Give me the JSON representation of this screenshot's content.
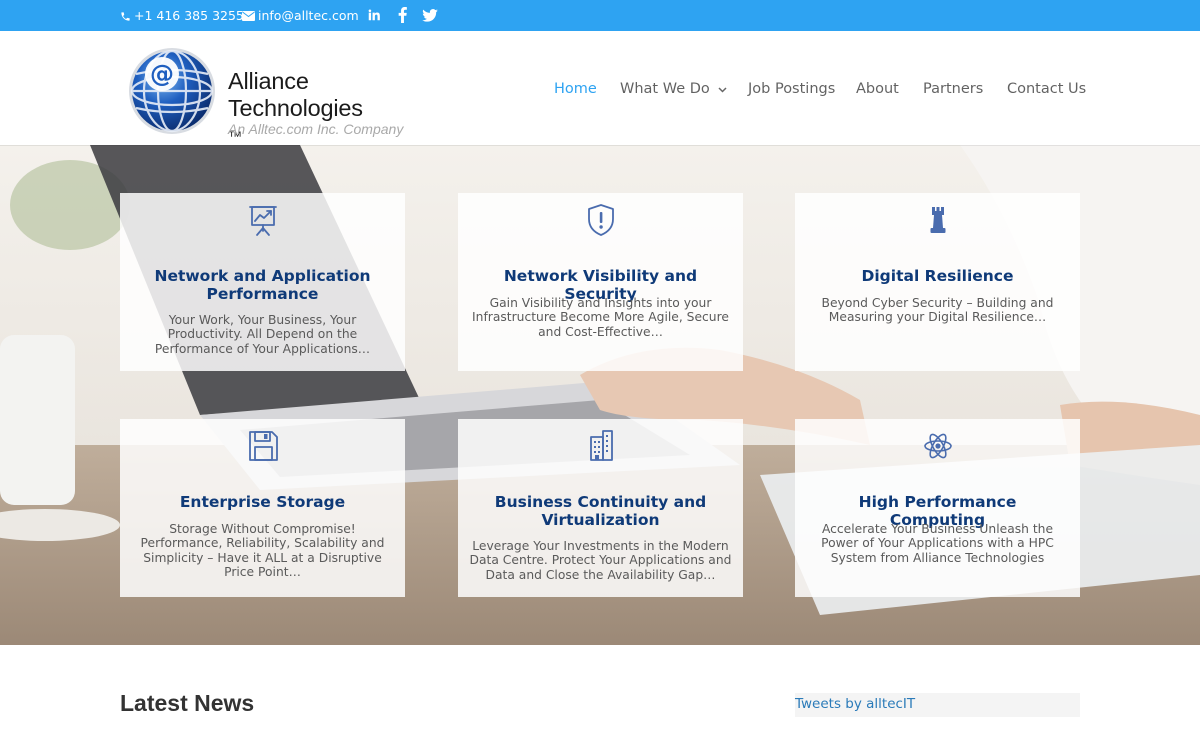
{
  "colors": {
    "accent": "#2ea3f2",
    "card_title": "#0f3a78",
    "icon": "#4a6cae"
  },
  "topbar": {
    "phone": "+1 416 385 3255",
    "email": "info@alltec.com",
    "social_icons": [
      "linkedin-icon",
      "facebook-icon",
      "twitter-icon"
    ]
  },
  "logo": {
    "name_line1": "Alliance",
    "name_line2": "Technologies",
    "trademark": "™",
    "tagline": "An Alltec.com Inc. Company"
  },
  "nav": {
    "items": [
      {
        "label": "Home",
        "active": true
      },
      {
        "label": "What We Do",
        "has_dropdown": true
      },
      {
        "label": "Job Postings"
      },
      {
        "label": "About"
      },
      {
        "label": "Partners"
      },
      {
        "label": "Contact Us"
      }
    ]
  },
  "services": [
    {
      "icon": "presentation-chart-icon",
      "title": "Network and Application Performance",
      "text": "Your Work, Your Business, Your Productivity. All Depend on the Performance of Your Applications…"
    },
    {
      "icon": "shield-alert-icon",
      "title": "Network Visibility and Security",
      "text": "Gain Visibility and Insights into your Infrastructure Become More Agile, Secure and Cost-Effective…"
    },
    {
      "icon": "chess-rook-icon",
      "title": "Digital Resilience",
      "text": "Beyond Cyber Security – Building and Measuring your Digital Resilience…"
    },
    {
      "icon": "floppy-disk-icon",
      "title": "Enterprise Storage",
      "text": "Storage Without Compromise! Performance, Reliability, Scalability and Simplicity – Have it ALL at a Disruptive Price Point…"
    },
    {
      "icon": "building-icon",
      "title": "Business Continuity and Virtualization",
      "text": "Leverage Your Investments in the Modern Data Centre. Protect Your Applications and Data and Close the Availability Gap…"
    },
    {
      "icon": "atom-icon",
      "title": "High Performance Computing",
      "text": "Accelerate Your Business Unleash the Power of Your Applications with a HPC System from Alliance Technologies"
    }
  ],
  "latest_news": {
    "heading": "Latest News"
  },
  "twitter": {
    "label": "Tweets by alltecIT"
  }
}
